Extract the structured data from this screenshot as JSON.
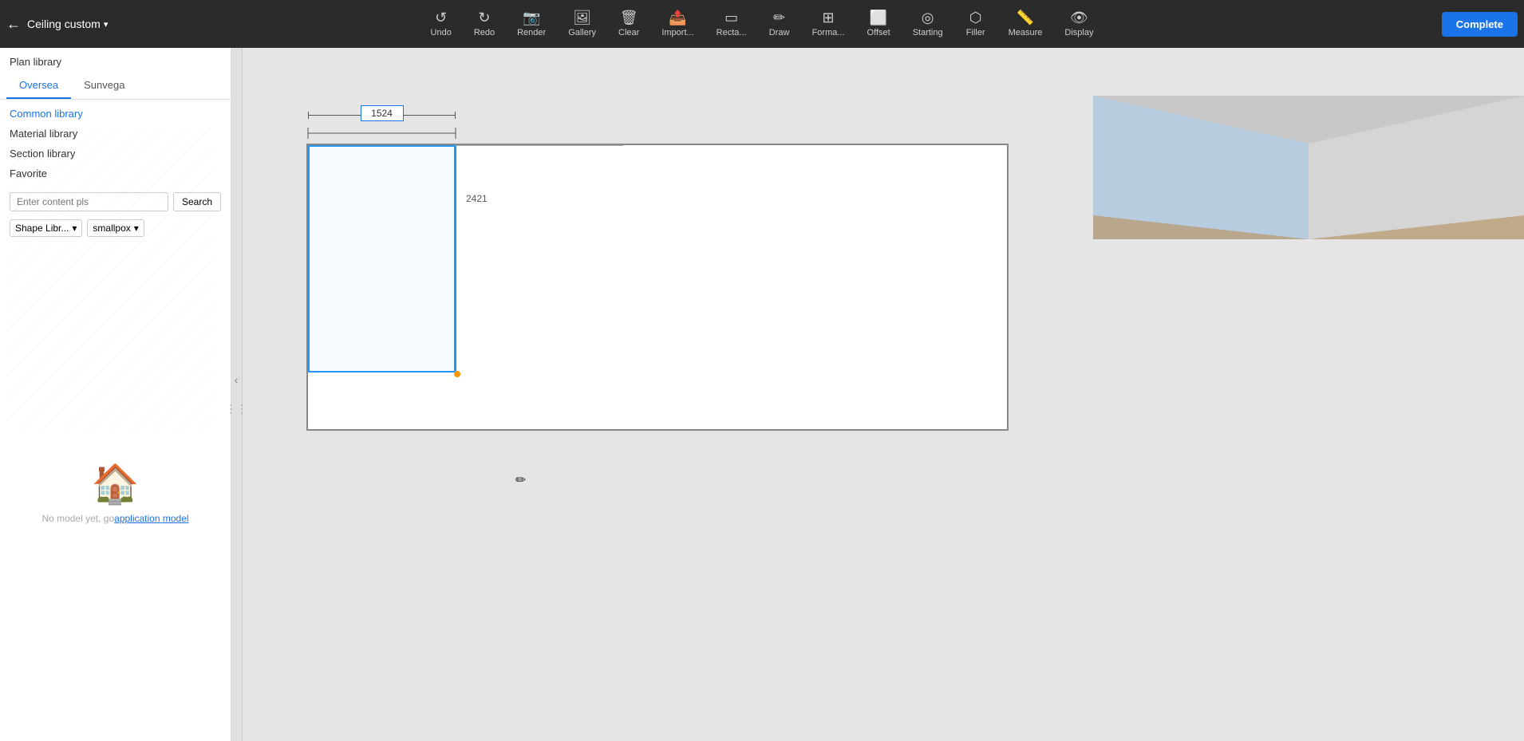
{
  "toolbar": {
    "back_icon": "←",
    "title": "Ceiling custom",
    "title_arrow": "▾",
    "tools": [
      {
        "id": "undo",
        "icon": "↺",
        "label": "Undo"
      },
      {
        "id": "redo",
        "icon": "↻",
        "label": "Redo"
      },
      {
        "id": "render",
        "icon": "📷",
        "label": "Render"
      },
      {
        "id": "gallery",
        "icon": "🖼",
        "label": "Gallery"
      },
      {
        "id": "clear",
        "icon": "🗑",
        "label": "Clear"
      },
      {
        "id": "import",
        "icon": "📤",
        "label": "Import..."
      },
      {
        "id": "recta",
        "icon": "▭",
        "label": "Recta..."
      },
      {
        "id": "draw",
        "icon": "✏",
        "label": "Draw"
      },
      {
        "id": "forma",
        "icon": "⊞",
        "label": "Forma..."
      },
      {
        "id": "offset",
        "icon": "⬜",
        "label": "Offset"
      },
      {
        "id": "starting",
        "icon": "◎",
        "label": "Starting"
      },
      {
        "id": "filler",
        "icon": "⬡",
        "label": "Filler"
      },
      {
        "id": "measure",
        "icon": "📏",
        "label": "Measure"
      },
      {
        "id": "display",
        "icon": "👁",
        "label": "Display"
      }
    ],
    "complete_label": "Complete"
  },
  "sidebar": {
    "plan_library_label": "Plan library",
    "tabs": [
      {
        "id": "oversea",
        "label": "Oversea",
        "active": true
      },
      {
        "id": "sunvega",
        "label": "Sunvega",
        "active": false
      }
    ],
    "nav_items": [
      {
        "id": "common-library",
        "label": "Common library",
        "highlighted": true
      },
      {
        "id": "material-library",
        "label": "Material library",
        "highlighted": false
      },
      {
        "id": "section-library",
        "label": "Section library",
        "highlighted": false
      },
      {
        "id": "favorite",
        "label": "Favorite",
        "highlighted": false
      }
    ],
    "search": {
      "placeholder": "Enter content pls",
      "button_label": "Search"
    },
    "filter1": {
      "label": "Shape Libr...",
      "arrow": "▾"
    },
    "filter2": {
      "label": "smallpox",
      "arrow": "▾"
    },
    "no_model_text": "No model yet, go",
    "no_model_link": "application model"
  },
  "canvas": {
    "dimension_top": "1524",
    "dimension_right": "2421"
  }
}
